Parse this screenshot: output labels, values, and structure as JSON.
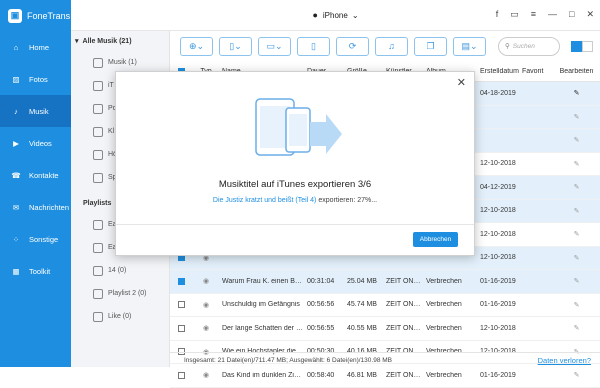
{
  "app": {
    "name": "FoneTrans",
    "device": "iPhone"
  },
  "sidebar": {
    "items": [
      {
        "label": "Home",
        "icon": "home-icon"
      },
      {
        "label": "Fotos",
        "icon": "photo-icon"
      },
      {
        "label": "Musik",
        "icon": "music-icon"
      },
      {
        "label": "Videos",
        "icon": "video-icon"
      },
      {
        "label": "Kontakte",
        "icon": "contacts-icon"
      },
      {
        "label": "Nachrichten",
        "icon": "messages-icon"
      },
      {
        "label": "Sonstige",
        "icon": "other-icon"
      },
      {
        "label": "Toolkit",
        "icon": "toolkit-icon"
      }
    ]
  },
  "categories": {
    "head": "Alle Musik (21)",
    "items": [
      "Musik (1)",
      "iT",
      "Po",
      "Kl",
      "Hö",
      "Sp"
    ],
    "playlist_head": "Playlists",
    "playlists": [
      "Ea",
      "Ea",
      "14 (0)",
      "Playlist 2 (0)",
      "Like (0)"
    ]
  },
  "toolbar": {
    "search_placeholder": "Suchen"
  },
  "table": {
    "headers": [
      "Typ",
      "Name",
      "Dauer",
      "Größe",
      "Künstler",
      "Album",
      "Erstelldatum",
      "Favorit",
      "Bearbeiten"
    ],
    "rows": [
      {
        "sel": true,
        "name": "",
        "dur": "",
        "size": "",
        "art": "",
        "alb": "",
        "date": "04-18-2019"
      },
      {
        "sel": true,
        "name": "",
        "dur": "",
        "size": "",
        "art": "",
        "alb": "",
        "date": ""
      },
      {
        "sel": true,
        "name": "",
        "dur": "",
        "size": "",
        "art": "",
        "alb": "",
        "date": ""
      },
      {
        "sel": false,
        "name": "",
        "dur": "",
        "size": "",
        "art": "",
        "alb": "",
        "date": "12-10-2018"
      },
      {
        "sel": true,
        "name": "",
        "dur": "",
        "size": "",
        "art": "",
        "alb": "",
        "date": "04-12-2019"
      },
      {
        "sel": true,
        "name": "",
        "dur": "",
        "size": "",
        "art": "",
        "alb": "",
        "date": "12-10-2018"
      },
      {
        "sel": false,
        "name": "",
        "dur": "",
        "size": "",
        "art": "",
        "alb": "",
        "date": "12-10-2018"
      },
      {
        "sel": true,
        "name": "",
        "dur": "",
        "size": "",
        "art": "",
        "alb": "",
        "date": "12-10-2018"
      },
      {
        "sel": true,
        "name": "Warum Frau K. einen Bun...",
        "dur": "00:31:04",
        "size": "25.04 MB",
        "art": "ZEIT ONLI...",
        "alb": "Verbrechen",
        "date": "01-16-2019"
      },
      {
        "sel": false,
        "name": "Unschuldig im Gefängnis",
        "dur": "00:56:56",
        "size": "45.74 MB",
        "art": "ZEIT ONLI...",
        "alb": "Verbrechen",
        "date": "01-16-2019"
      },
      {
        "sel": false,
        "name": "Der lange Schatten der R...",
        "dur": "00:56:55",
        "size": "40.55 MB",
        "art": "ZEIT ONLI...",
        "alb": "Verbrechen",
        "date": "12-10-2018"
      },
      {
        "sel": false,
        "name": "Wie ein Hochstapler die f...",
        "dur": "00:50:30",
        "size": "40.16 MB",
        "art": "ZEIT ONLI...",
        "alb": "Verbrechen",
        "date": "12-10-2018"
      },
      {
        "sel": false,
        "name": "Das Kind im dunklen Zim...",
        "dur": "00:58:40",
        "size": "46.81 MB",
        "art": "ZEIT ONLI...",
        "alb": "Verbrechen",
        "date": "01-16-2019"
      }
    ]
  },
  "footer": {
    "status": "Insgesamt: 21 Datei(en)/711.47 MB; Ausgewählt: 6 Datei(en)/130.98 MB",
    "lost_link": "Daten verloren?"
  },
  "modal": {
    "title": "Musiktitel auf iTunes exportieren 3/6",
    "sub_highlight": "Die Justiz kratzt und beißt (Teil 4)",
    "sub_rest": " exportieren: 27%...",
    "button": "Abbrechen",
    "progress_percent": 27
  }
}
